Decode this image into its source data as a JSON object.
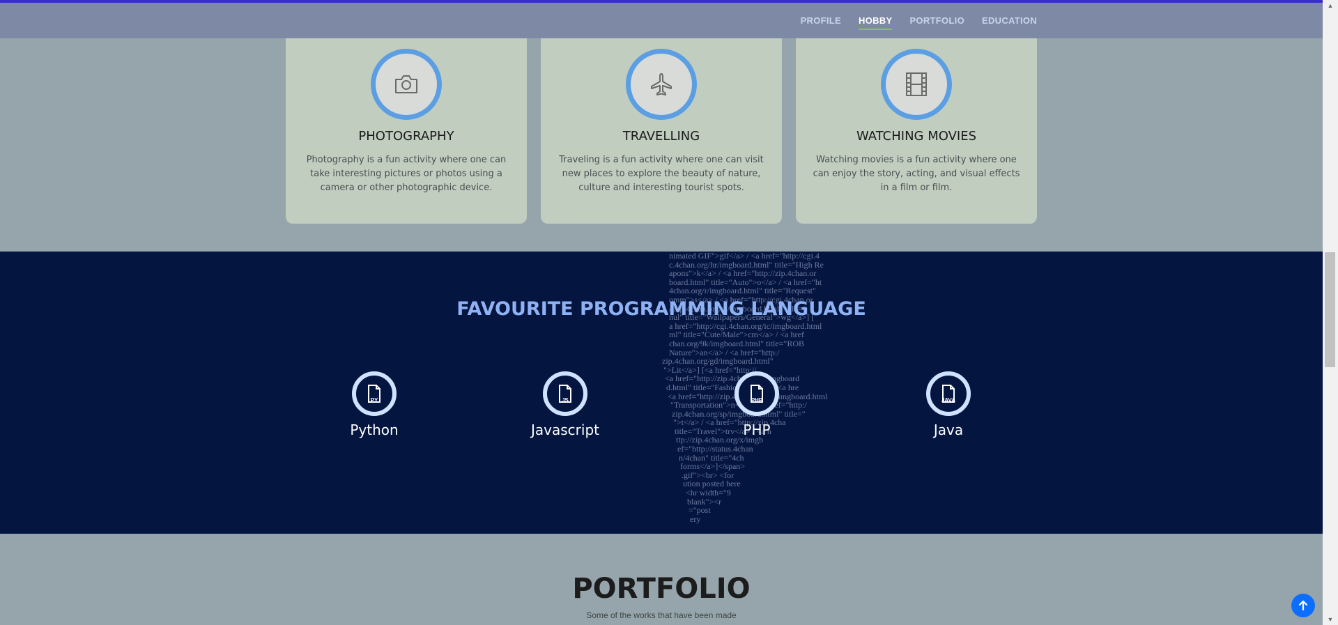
{
  "nav": {
    "items": [
      {
        "label": "PROFILE",
        "active": false
      },
      {
        "label": "HOBBY",
        "active": true
      },
      {
        "label": "PORTFOLIO",
        "active": false
      },
      {
        "label": "EDUCATION",
        "active": false
      }
    ]
  },
  "hobbies": [
    {
      "icon": "camera-icon",
      "title": "PHOTOGRAPHY",
      "text": "Photography is a fun activity where one can take interesting pictures or photos using a camera or other photographic device."
    },
    {
      "icon": "airplane-icon",
      "title": "TRAVELLING",
      "text": "Traveling is a fun activity where one can visit new places to explore the beauty of nature, culture and interesting tourist spots."
    },
    {
      "icon": "film-icon",
      "title": "WATCHING MOVIES",
      "text": "Watching movies is a fun activity where one can enjoy the story, acting, and visual effects in a film or film."
    }
  ],
  "languages": {
    "title": "FAVOURITE PROGRAMMING LANGUAGE",
    "items": [
      {
        "name": "Python",
        "badge": "PY"
      },
      {
        "name": "Javascript",
        "badge": "JS"
      },
      {
        "name": "PHP",
        "badge": "PHP"
      },
      {
        "name": "Java",
        "badge": "JAVA"
      }
    ],
    "code_art_lines": [
      "nimated GIF\">gif</a> / <a href=\"http://cgi.4",
      "c.4chan.org/hr/imgboard.html\" title=\"High Re",
      "apons\">k</a> / <a href=\"http://zip.4chan.or",
      "board.html\" title=\"Auto\">o</a> / <a href=\"ht",
      "4chan.org/r/imgboard.html\" title=\"Request\"",
      "omm\">s</a> / <a href=\"http://cgi.4chan.or",
      "//zip.4chan.org/w/imgboard.html\" title=\"",
      "nul\" title=\"Wallpapers/General\">wg</a>] [",
      "a href=\"http://cgi.4chan.org/ic/imgboard.html",
      "ml\" title=\"Cute/Male\">cm</a> / <a href",
      "chan.org/9k/imgboard.html\" title=\"ROB",
      "Nature\">an</a> / <a href=\"http:/",
      "zip.4chan.org/gd/imgboard.html\"",
      "\">Lit</a>] [<a href=\"http://",
      "<a href=\"http://zip.4chan.org/rimgboard",
      "d.html\" title=\"Fashion\">fa</a> / <a hre",
      "<a href=\"http://zip.4chan.org/po/imgboard.html",
      "\"Transportation\">n</a> / <a href=\"http:/",
      "zip.4chan.org/sp/imgboard.html\" title=\"",
      "\">t</a> / <a href=\"http://zip.4cha",
      "title=\"Travel\">trv</a> / <a h",
      "ttp://zip.4chan.org/x/imgb",
      "ef=\"http://status.4chan",
      "n/4chan\" title=\"4ch",
      "forms</a>]</span>",
      ".gif\"><br> <for",
      "ution posted here",
      "<hr width=\"9",
      "blank\"><r",
      "=\"post",
      "ery"
    ]
  },
  "portfolio": {
    "title": "PORTFOLIO",
    "subtitle": "Some of the works that have been made"
  },
  "controls": {
    "back_to_top_icon": "arrow-up-icon"
  }
}
